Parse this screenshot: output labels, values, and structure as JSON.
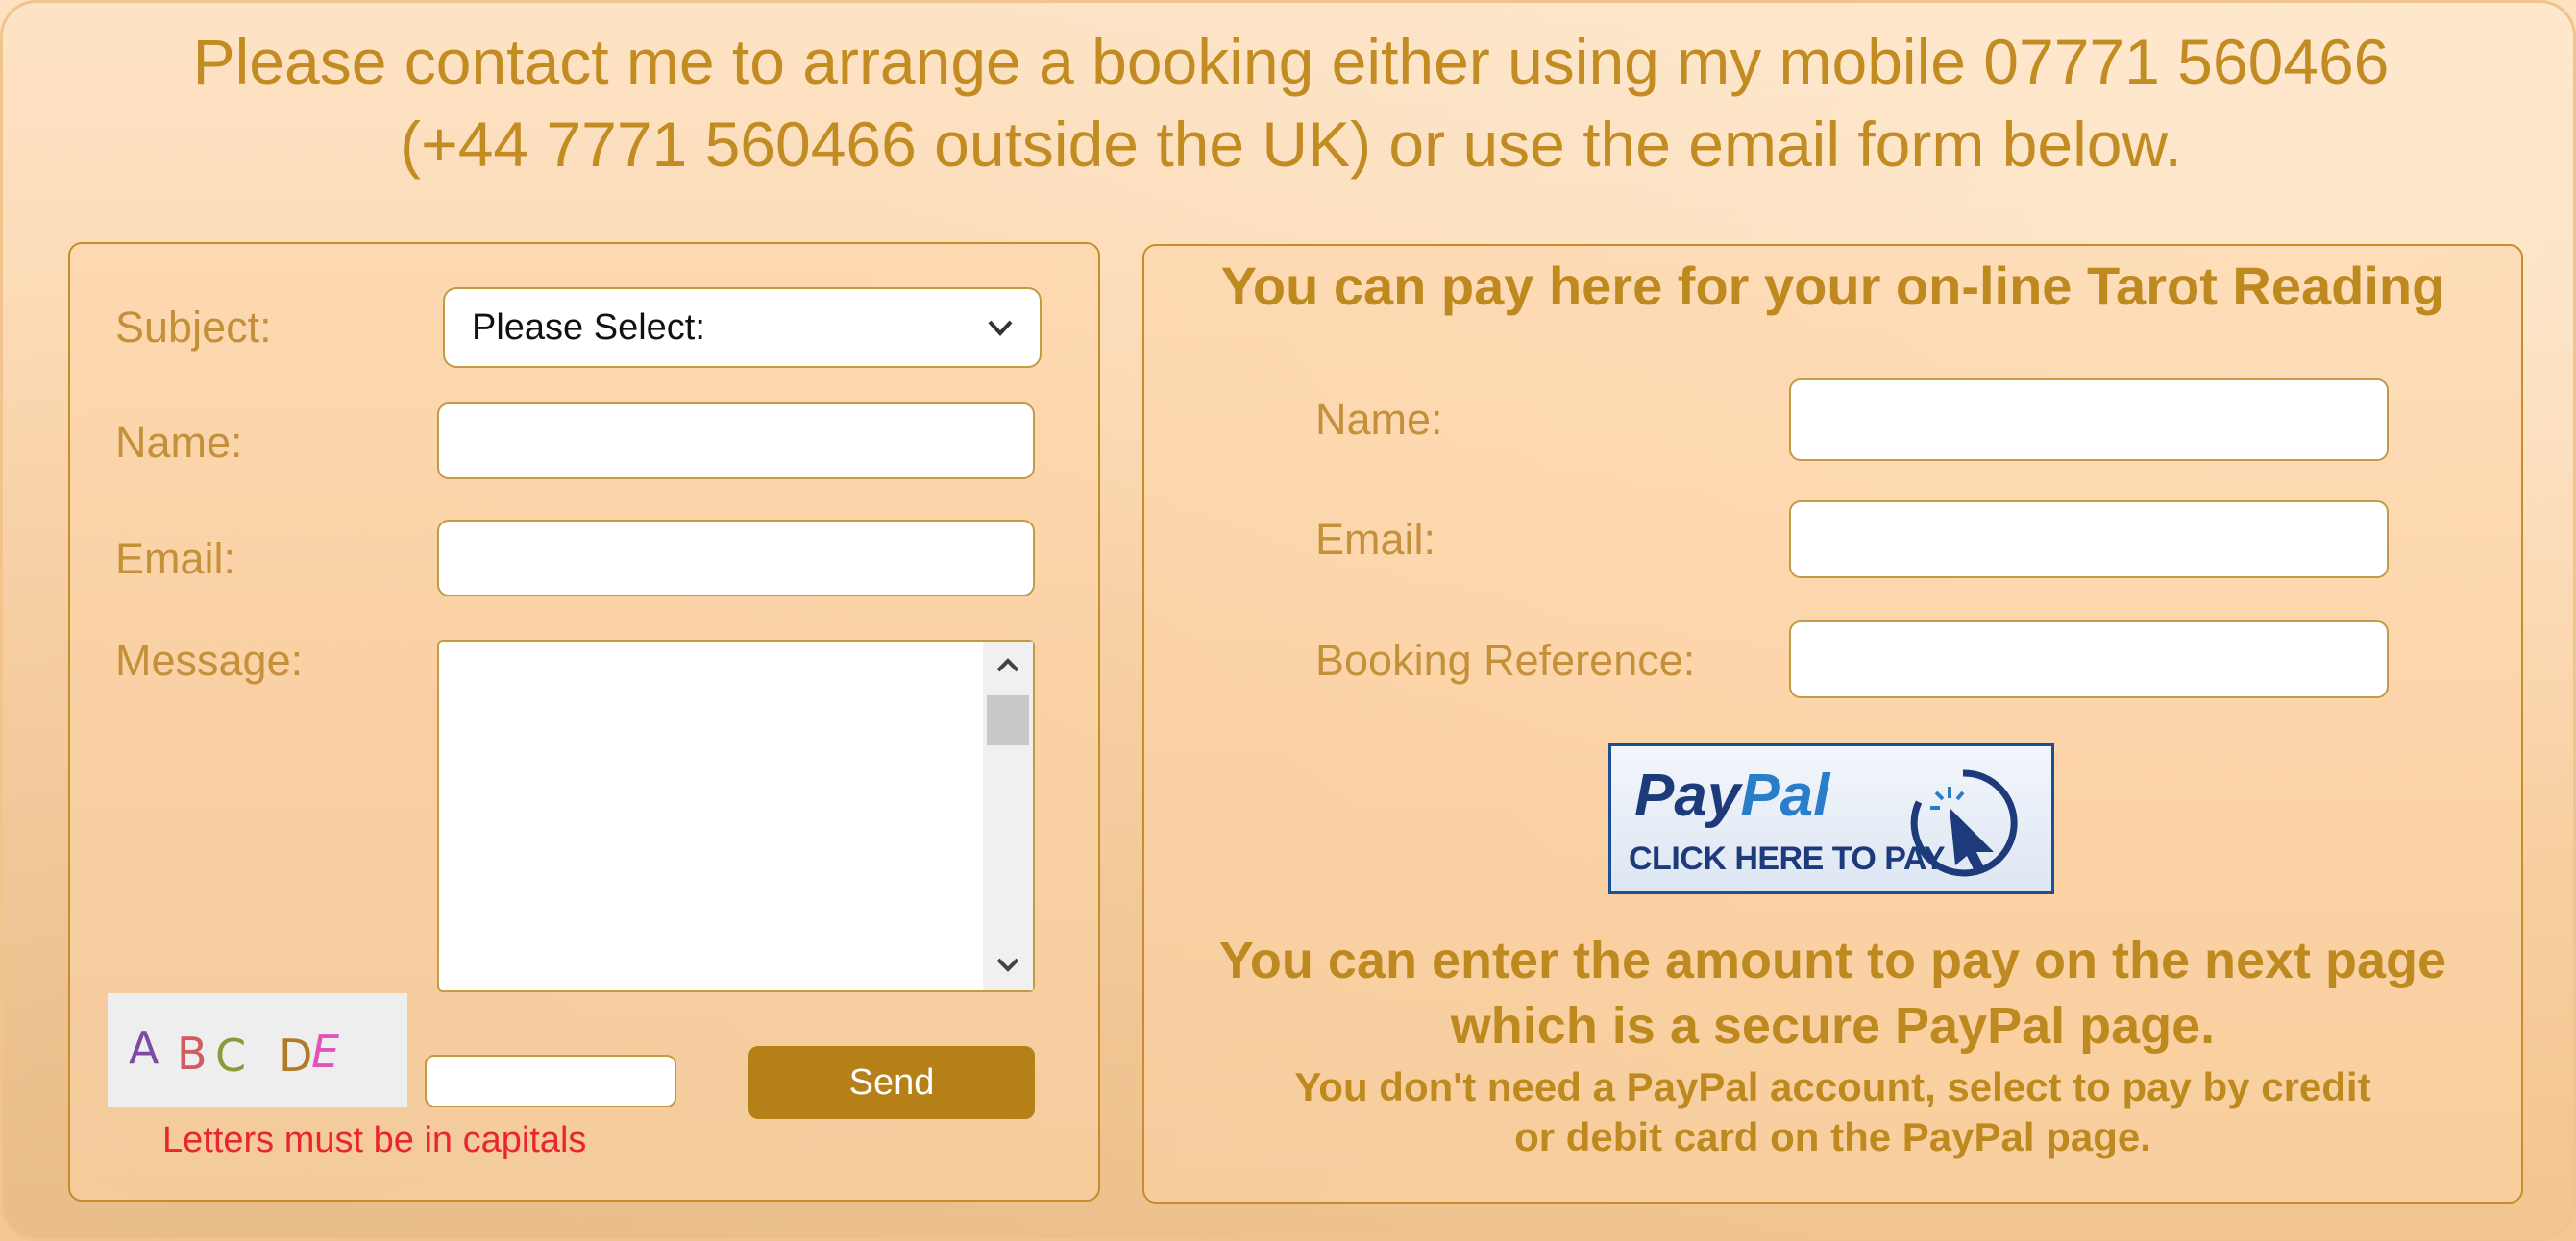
{
  "header": {
    "line1": "Please contact me to arrange a booking either using my mobile 07771 560466",
    "line2": "(+44 7771 560466 outside the UK) or use the email form below."
  },
  "contact_form": {
    "subject_label": "Subject:",
    "subject_value": "Please Select:",
    "name_label": "Name:",
    "email_label": "Email:",
    "message_label": "Message:",
    "captcha": [
      "A",
      "B",
      "C",
      "D",
      "E"
    ],
    "captcha_colors": [
      "#7d4aa4",
      "#d45a62",
      "#8a9a3a",
      "#b07a2a",
      "#e056b8"
    ],
    "send_label": "Send",
    "warning": "Letters must be in capitals"
  },
  "payment_form": {
    "title": "You can pay here for your on-line Tarot Reading",
    "name_label": "Name:",
    "email_label": "Email:",
    "booking_label": "Booking Reference:",
    "paypal_logo_a": "Pay",
    "paypal_logo_b": "Pal",
    "paypal_sub": "CLICK HERE TO PAY",
    "info_line1": "You can enter the amount to pay on the next page",
    "info_line2": "which is a secure PayPal page.",
    "info_line3": "You don't need a PayPal account, select to pay by credit",
    "info_line4": "or debit card on the PayPal page."
  }
}
